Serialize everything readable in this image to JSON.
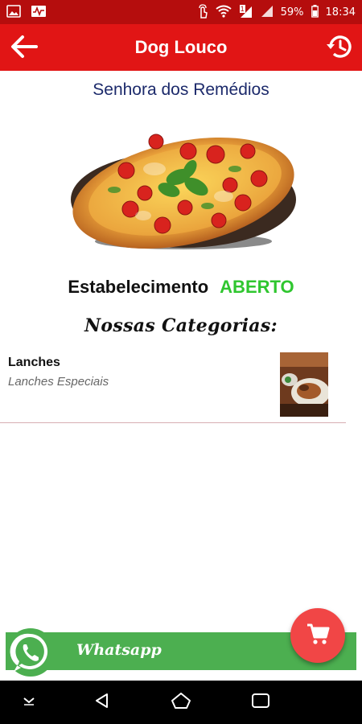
{
  "status_bar": {
    "battery": "59%",
    "time": "18:34",
    "sim_label": "1"
  },
  "app_bar": {
    "title": "Dog Louco"
  },
  "store": {
    "name": "Senhora dos Remédios",
    "status_label": "Estabelecimento",
    "status_value": "ABERTO"
  },
  "categories": {
    "title": "Nossas Categorias:",
    "items": [
      {
        "name": "Lanches",
        "description": "Lanches Especiais"
      }
    ]
  },
  "whatsapp": {
    "label": "Whatsapp"
  },
  "colors": {
    "status_bar": "#b50d0d",
    "app_bar": "#e11515",
    "open_status": "#2fc62f",
    "store_name": "#1c2a6b",
    "whatsapp_bar": "#4caf50",
    "fab": "#f14646"
  },
  "icons": {
    "back": "arrow-left-icon",
    "history": "history-icon",
    "cart": "shopping-cart-icon",
    "whatsapp": "whatsapp-icon"
  }
}
